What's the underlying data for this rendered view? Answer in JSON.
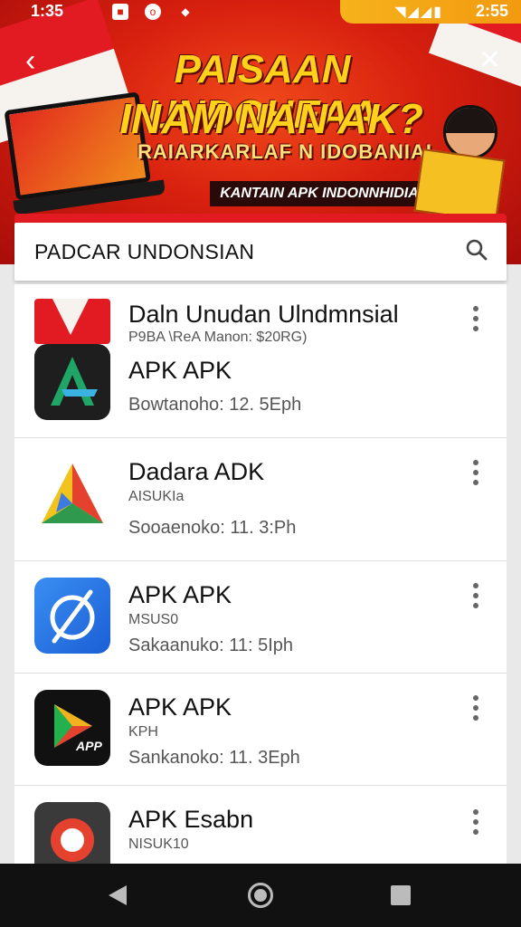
{
  "status_bar": {
    "time": "1:35",
    "clock": "2:55"
  },
  "banner": {
    "headline_1": "PAISAAN UNDOHEAA",
    "headline_2": "INAM NAN AK?",
    "headline_3": "RAIARKARLAF N IDOBANIAI",
    "sub_banner": "KANTAIN APK INDONNHIDIA"
  },
  "search": {
    "query": "PADCAR UNDONSIAN"
  },
  "list": {
    "items": [
      {
        "title": "Daln Unudan Ulndmnsial",
        "sub": "P9BA \\ReA Manon:  $20RG)",
        "name": "APK APK",
        "meta": "Bowtanoho: 12. 5Eph"
      },
      {
        "title": "Dadara ADK",
        "sub": "AISUKIa",
        "meta": "Sooaenoko: 11. 3:Ph"
      },
      {
        "title": "APK APK",
        "sub": "MSUS0",
        "meta": "Sakaanuko: 11: 5Iph"
      },
      {
        "title": "APK APK",
        "sub": "KPH",
        "meta": "Sankanoko: 11. 3Eph"
      },
      {
        "title": "APK Esabn",
        "sub": "NISUK10"
      }
    ],
    "icon_labels": {
      "item4": "APP"
    }
  },
  "colors": {
    "brand_red": "#e21b22",
    "banner_yellow": "#ffd11a",
    "accent_orange": "#f29a10"
  }
}
